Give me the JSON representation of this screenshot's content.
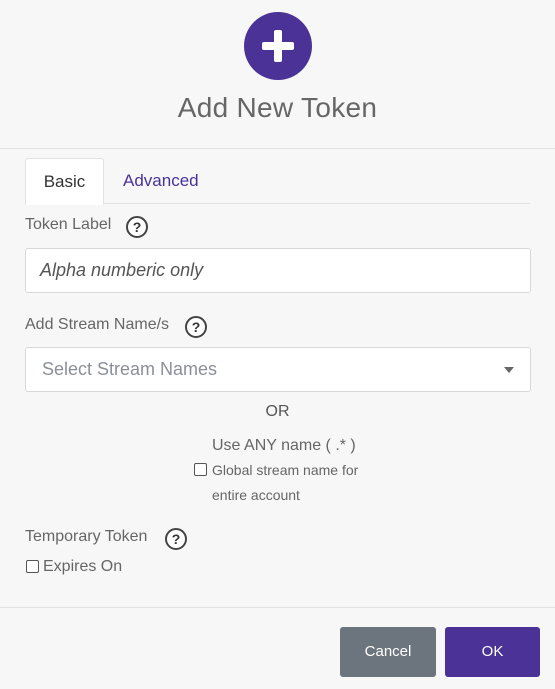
{
  "header": {
    "title": "Add New Token",
    "icon": "plus-circle-icon",
    "accent_color": "#4a3296"
  },
  "tabs": [
    {
      "label": "Basic",
      "active": true
    },
    {
      "label": "Advanced",
      "active": false
    }
  ],
  "token_label": {
    "label": "Token Label",
    "help": "?",
    "placeholder": "Alpha numberic only"
  },
  "stream_names": {
    "label": "Add Stream Name/s",
    "help": "?",
    "placeholder": "Select Stream Names"
  },
  "or_text": "OR",
  "any_name": {
    "label": "Use ANY name ( .* )",
    "checkbox_line1": "Global stream name for",
    "checkbox_line2": "entire account",
    "checked": false
  },
  "temporary_token": {
    "label": "Temporary Token",
    "help": "?",
    "expires_label": "Expires On",
    "checked": false
  },
  "footer": {
    "cancel_label": "Cancel",
    "ok_label": "OK",
    "cancel_color": "#6c757d",
    "ok_color": "#4a3296"
  }
}
